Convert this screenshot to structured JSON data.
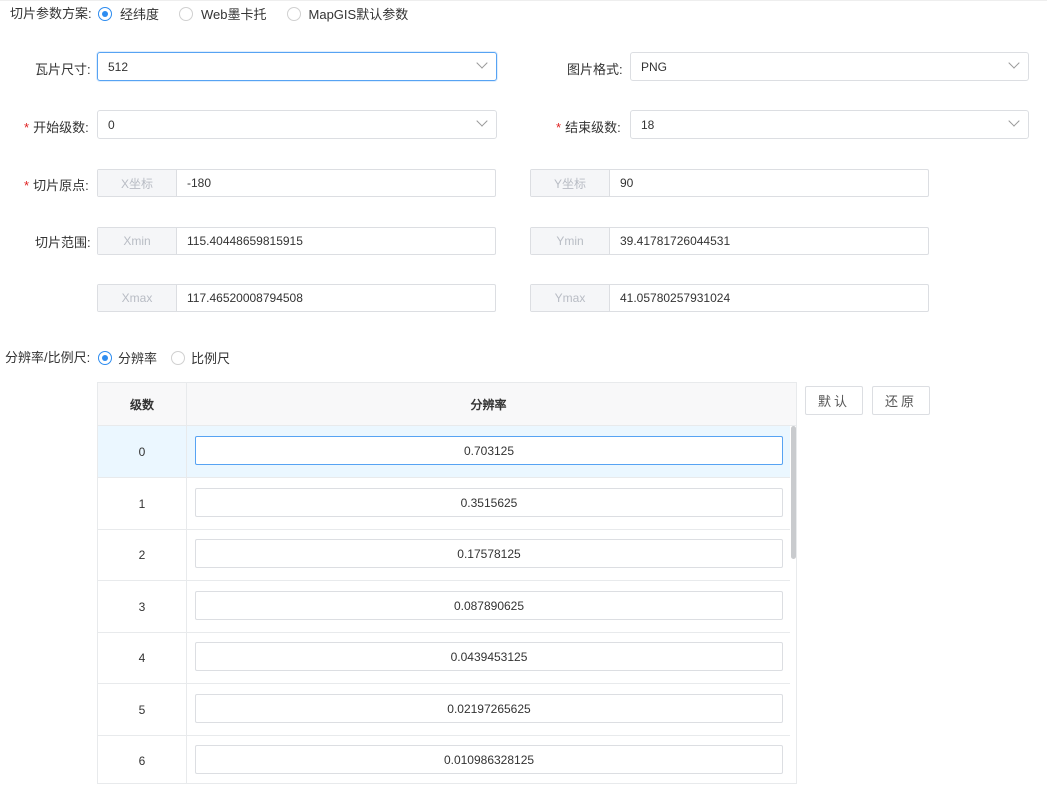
{
  "scheme": {
    "label": "切片参数方案:",
    "options": [
      "经纬度",
      "Web墨卡托",
      "MapGIS默认参数"
    ],
    "selected": "经纬度"
  },
  "tile_size": {
    "label": "瓦片尺寸:",
    "value": "512"
  },
  "image_format": {
    "label": "图片格式:",
    "value": "PNG"
  },
  "start_level": {
    "required": "*",
    "label": "开始级数:",
    "value": "0"
  },
  "end_level": {
    "required": "*",
    "label": "结束级数:",
    "value": "18"
  },
  "origin": {
    "required": "*",
    "label": "切片原点:",
    "x_prefix": "X坐标",
    "x_value": "-180",
    "y_prefix": "Y坐标",
    "y_value": "90"
  },
  "extent": {
    "label": "切片范围:",
    "xmin_prefix": "Xmin",
    "xmin": "115.40448659815915",
    "ymin_prefix": "Ymin",
    "ymin": "39.41781726044531",
    "xmax_prefix": "Xmax",
    "xmax": "117.46520008794508",
    "ymax_prefix": "Ymax",
    "ymax": "41.05780257931024"
  },
  "mode": {
    "label": "分辨率/比例尺:",
    "options": [
      "分辨率",
      "比例尺"
    ],
    "selected": "分辨率"
  },
  "buttons": {
    "default": "默认",
    "restore": "还原"
  },
  "table": {
    "columns": [
      "级数",
      "分辨率"
    ],
    "rows": [
      {
        "level": "0",
        "resolution": "0.703125"
      },
      {
        "level": "1",
        "resolution": "0.3515625"
      },
      {
        "level": "2",
        "resolution": "0.17578125"
      },
      {
        "level": "3",
        "resolution": "0.087890625"
      },
      {
        "level": "4",
        "resolution": "0.0439453125"
      },
      {
        "level": "5",
        "resolution": "0.02197265625"
      },
      {
        "level": "6",
        "resolution": "0.010986328125"
      }
    ]
  },
  "colors": {
    "accent": "#2d8cf0",
    "required": "#e02020",
    "row_highlight": "#ebf7ff"
  }
}
